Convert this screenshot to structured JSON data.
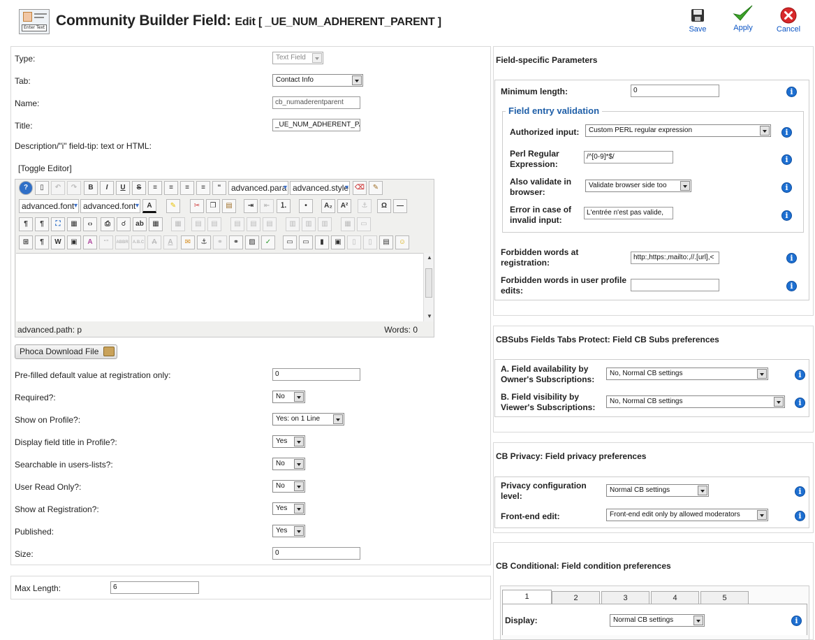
{
  "header": {
    "title": "Community Builder Field:",
    "subtitle": "Edit [ _UE_NUM_ADHERENT_PARENT ]",
    "icon_text": "Enter Text",
    "toolbar": {
      "save": "Save",
      "apply": "Apply",
      "cancel": "Cancel"
    }
  },
  "left": {
    "type_label": "Type:",
    "type_value": "Text Field",
    "tab_label": "Tab:",
    "tab_value": "Contact Info",
    "name_label": "Name:",
    "name_value": "cb_numaderentparent",
    "title_label": "Title:",
    "title_value": "_UE_NUM_ADHERENT_PA",
    "description_label": "Description/\"i\" field-tip: text or HTML:",
    "toggle_editor": "[Toggle Editor]",
    "editor": {
      "paragraph_select": "advanced.para",
      "style_select": "advanced.style",
      "font_select": "advanced.font",
      "fontsize_select": "advanced.font",
      "path": "advanced.path: p",
      "words": "Words: 0"
    },
    "phoca_button": "Phoca Download File",
    "prefilled_label": "Pre-filled default value at registration only:",
    "prefilled_value": "0",
    "required_label": "Required?:",
    "required_value": "No",
    "show_profile_label": "Show on Profile?:",
    "show_profile_value": "Yes: on 1 Line",
    "display_title_label": "Display field title in Profile?:",
    "display_title_value": "Yes",
    "searchable_label": "Searchable in users-lists?:",
    "searchable_value": "No",
    "readonly_label": "User Read Only?:",
    "readonly_value": "No",
    "show_reg_label": "Show at Registration?:",
    "show_reg_value": "Yes",
    "published_label": "Published:",
    "published_value": "Yes",
    "size_label": "Size:",
    "size_value": "0",
    "maxlength_label": "Max Length:",
    "maxlength_value": "6"
  },
  "right": {
    "field_specific": {
      "title": "Field-specific Parameters",
      "min_length_label": "Minimum length:",
      "min_length_value": "0",
      "validation_legend": "Field entry validation",
      "authorized_label": "Authorized input:",
      "authorized_value": "Custom PERL regular expression",
      "perl_label": "Perl Regular Expression:",
      "perl_value": "/^[0-9]*$/",
      "browser_label": "Also validate in browser:",
      "browser_value": "Validate browser side too",
      "error_label": "Error in case of invalid input:",
      "error_value": "L'entrée n'est pas valide,",
      "forbidden_reg_label": "Forbidden words at registration:",
      "forbidden_reg_value": "http:,https:,mailto:,//.[url],<",
      "forbidden_edit_label": "Forbidden words in user profile edits:",
      "forbidden_edit_value": ""
    },
    "cbsubs": {
      "title": "CBSubs Fields Tabs Protect: Field CB Subs preferences",
      "a_label": "A. Field availability by Owner's Subscriptions:",
      "a_value": "No, Normal CB settings",
      "b_label": "B. Field visibility by Viewer's Subscriptions:",
      "b_value": "No, Normal CB settings"
    },
    "privacy": {
      "title": "CB Privacy: Field privacy preferences",
      "level_label": "Privacy configuration level:",
      "level_value": "Normal CB settings",
      "frontend_label": "Front-end edit:",
      "frontend_value": "Front-end edit only by allowed moderators"
    },
    "conditional": {
      "title": "CB Conditional: Field condition preferences",
      "tabs": [
        "1",
        "2",
        "3",
        "4",
        "5"
      ],
      "display_label": "Display:",
      "display_value": "Normal CB settings"
    }
  },
  "colors": {
    "link_blue": "#0b55c4",
    "info_blue": "#1d6fd1",
    "legend_blue": "#1f5fa8"
  }
}
